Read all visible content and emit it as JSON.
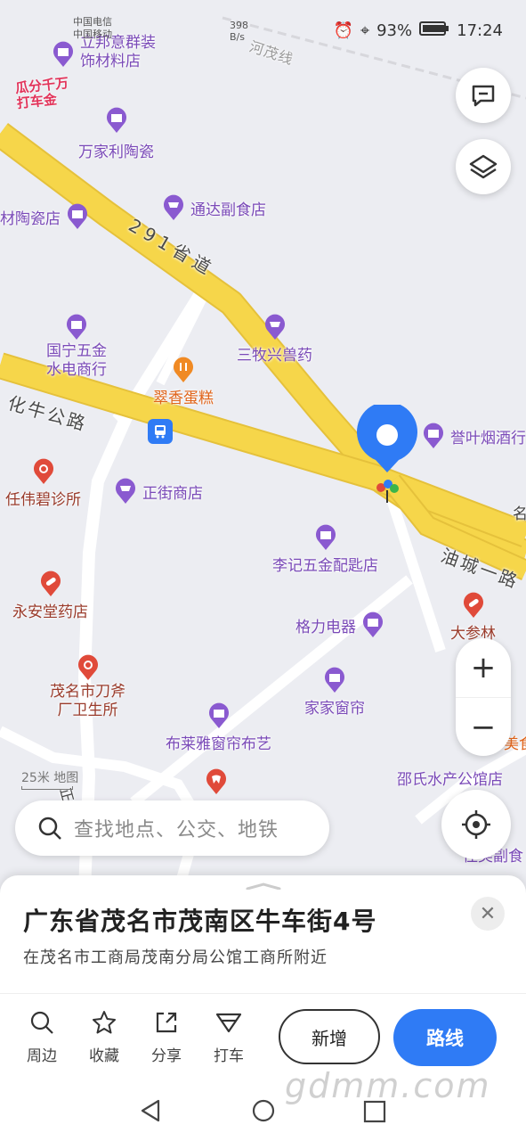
{
  "status": {
    "carrier1": "中国电信",
    "carrier2": "中国移动",
    "net_speed": "398",
    "net_unit": "B/s",
    "battery": "93%",
    "time": "17:24"
  },
  "map": {
    "road_labels": [
      "291省道",
      "化牛公路",
      "油城一路",
      "河茂线",
      "正"
    ],
    "promo_text": "瓜分千万\n打车金",
    "pois": [
      {
        "name": "立邦意群装饰材料店",
        "l1": "立邦意群装",
        "l2": "饰材料店",
        "icon": "shop-icon"
      },
      {
        "name": "万家利陶瓷",
        "icon": "shop-icon"
      },
      {
        "name": "材陶瓷店",
        "icon": "shop-icon"
      },
      {
        "name": "通达副食店",
        "icon": "cart-icon"
      },
      {
        "name": "国宁五金水电商行",
        "l1": "国宁五金",
        "l2": "水电商行",
        "icon": "shop-icon"
      },
      {
        "name": "三牧兴兽药",
        "icon": "cart-icon"
      },
      {
        "name": "翠香蛋糕",
        "icon": "fork-icon"
      },
      {
        "name": "誉叶烟酒行",
        "icon": "shop-icon"
      },
      {
        "name": "任伟碧诊所",
        "icon": "stethoscope-icon"
      },
      {
        "name": "正街商店",
        "icon": "cart-icon"
      },
      {
        "name": "李记五金配匙店",
        "icon": "shop-icon"
      },
      {
        "name": "永安堂药店",
        "icon": "pill-icon"
      },
      {
        "name": "格力电器",
        "icon": "shop-icon"
      },
      {
        "name": "大参林",
        "icon": "pill-icon"
      },
      {
        "name": "茂名市刀斧厂卫生所",
        "l1": "茂名市刀斧",
        "l2": "厂卫生所",
        "icon": "stethoscope-icon"
      },
      {
        "name": "家家窗帘",
        "icon": "shop-icon"
      },
      {
        "name": "布莱雅窗帘布艺",
        "icon": "shop-icon"
      },
      {
        "name": "邵氏水产公馆店",
        "icon": "shop-icon"
      },
      {
        "name": "佳美副食",
        "icon": "cart-icon"
      },
      {
        "name": "名",
        "icon": ""
      },
      {
        "name": "美食",
        "icon": ""
      }
    ],
    "scale": "25米",
    "logo": "地图"
  },
  "search": {
    "placeholder": "查找地点、公交、地铁"
  },
  "zoom": {
    "in": "+",
    "out": "−"
  },
  "sheet": {
    "address": "广东省茂名市茂南区牛车街4号",
    "nearby": "在茂名市工商局茂南分局公馆工商所附近",
    "actions": [
      {
        "label": "周边",
        "icon": "search-icon"
      },
      {
        "label": "收藏",
        "icon": "star-icon"
      },
      {
        "label": "分享",
        "icon": "share-icon"
      },
      {
        "label": "打车",
        "icon": "taxi-icon"
      }
    ],
    "add_label": "新增",
    "route_label": "路线"
  },
  "watermark": "gdmm.com",
  "colors": {
    "accent": "#2f7bf5",
    "road": "#f6d64a",
    "poi": "#7a4ab8"
  }
}
